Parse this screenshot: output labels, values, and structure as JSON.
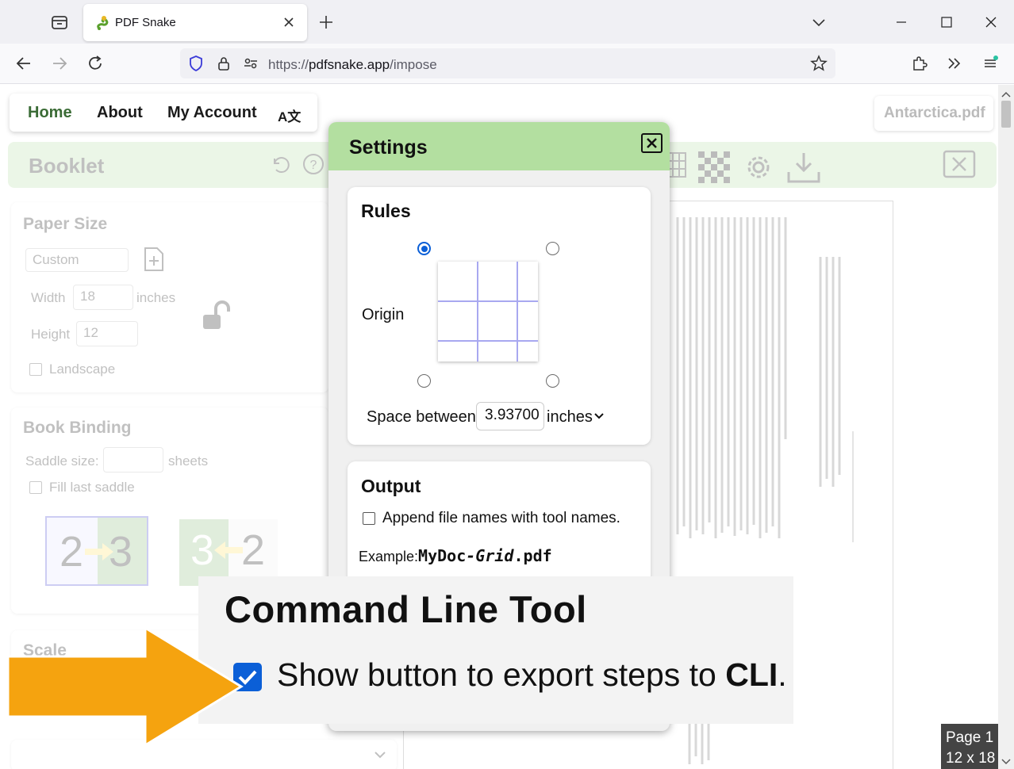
{
  "browser": {
    "tab_title": "PDF Snake",
    "url_scheme": "https://",
    "url_host": "pdfsnake.app",
    "url_path": "/impose"
  },
  "nav": {
    "home": "Home",
    "about": "About",
    "my_account": "My Account",
    "language": "A文"
  },
  "file_name": "Antarctica.pdf",
  "tool": {
    "title": "Booklet",
    "paper_size": {
      "heading": "Paper Size",
      "preset": "Custom",
      "width_label": "Width",
      "width_value": "18",
      "unit": "inches",
      "height_label": "Height",
      "height_value": "12",
      "landscape_label": "Landscape"
    },
    "book_binding": {
      "heading": "Book Binding",
      "saddle_label": "Saddle size:",
      "saddle_unit": "sheets",
      "fill_last_label": "Fill last saddle",
      "option_a_left": "2",
      "option_a_right": "3",
      "option_b_left": "3",
      "option_b_right": "2"
    },
    "scale_heading": "Scale"
  },
  "page_indicator": {
    "page": "Page 1",
    "size": "12 x 18"
  },
  "settings": {
    "title": "Settings",
    "rules": {
      "heading": "Rules",
      "origin_label": "Origin",
      "space_label": "Space between",
      "space_value": "3.93700",
      "space_unit": "inches"
    },
    "output": {
      "heading": "Output",
      "append_label": "Append file names with tool names.",
      "example_label": "Example:",
      "example_base": "MyDoc",
      "example_suffix": "-Grid",
      "example_ext": ".pdf"
    }
  },
  "callout": {
    "title": "Command Line Tool",
    "checkbox_text": "Show button to export steps to ",
    "checkbox_bold": "CLI",
    "checkbox_end": ".",
    "arrow_color": "#f5a30f"
  }
}
